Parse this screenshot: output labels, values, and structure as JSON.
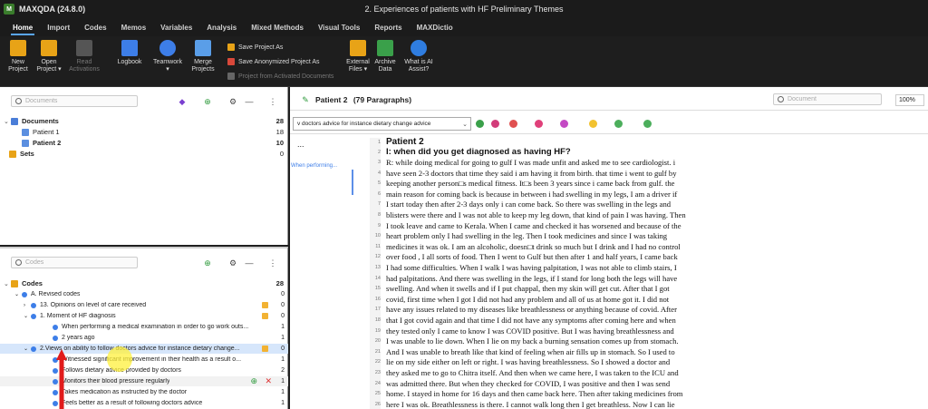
{
  "window": {
    "app_name": "MAXQDA (24.8.0)",
    "doc_title": "2. Experiences of patients with HF Preliminary Themes"
  },
  "ribbon": {
    "tabs": [
      "Home",
      "Import",
      "Codes",
      "Memos",
      "Variables",
      "Analysis",
      "Mixed Methods",
      "Visual Tools",
      "Reports",
      "MAXDictio"
    ],
    "buttons": [
      {
        "label": "New\nProject",
        "icon": "new-project-icon"
      },
      {
        "label": "Open\nProject ▾",
        "icon": "open-project-icon"
      },
      {
        "label": "Read\nActivations",
        "icon": "read-icon",
        "disabled": true
      },
      {
        "label": "Logbook",
        "icon": "logbook-icon"
      },
      {
        "label": "Teamwork\n▾",
        "icon": "teamwork-icon"
      },
      {
        "label": "Merge\nProjects",
        "icon": "merge-icon"
      },
      {
        "label": "External\nFiles ▾",
        "icon": "external-files-icon"
      },
      {
        "label": "Archive\nData",
        "icon": "archive-icon"
      },
      {
        "label": "What is AI\nAssist?",
        "icon": "ai-assist-icon"
      }
    ],
    "small_buttons": [
      "Save Project As",
      "Save Anonymized Project As",
      "Project from Activated Documents"
    ]
  },
  "documents": {
    "search_placeholder": "Documents",
    "root": {
      "label": "Documents",
      "count": "28"
    },
    "items": [
      {
        "label": "Patient 1",
        "count": "18"
      },
      {
        "label": "Patient 2",
        "count": "10"
      }
    ],
    "sets": {
      "label": "Sets",
      "count": "0"
    }
  },
  "codes": {
    "search_placeholder": "Codes",
    "root": {
      "label": "Codes",
      "count": "28"
    },
    "rows": [
      {
        "label": "A. Revised codes",
        "count": "0"
      },
      {
        "label": "13. Opinions on level of care received",
        "count": "0"
      },
      {
        "label": "1. Moment of HF diagnosis",
        "count": "0"
      },
      {
        "label": "When performing a medical examination in order to go work outs...",
        "count": "1"
      },
      {
        "label": "2 years ago",
        "count": "1"
      },
      {
        "label": "2.Views on ability to follow doctors advice for instance dietary change...",
        "count": "0"
      },
      {
        "label": "Witnessed significant improvement in their health as a result o...",
        "count": "1"
      },
      {
        "label": "Follows dietary advice provided by doctors",
        "count": "2"
      },
      {
        "label": "Monitors their blood pressure regularly",
        "count": "1"
      },
      {
        "label": "Takes medication as instructed by the doctor",
        "count": "1"
      },
      {
        "label": "Feels better as a result of following doctors advice",
        "count": "1"
      }
    ]
  },
  "document_browser": {
    "title": "Patient 2",
    "paragraphs": "(79 Paragraphs)",
    "search_placeholder": "Document",
    "zoom": "100%",
    "code_combo": "v doctors advice for instance dietary change advice",
    "margin_label": "When performing...",
    "ellipsis": "...",
    "lines": [
      {
        "n": "1",
        "text": "Patient 2",
        "style": "h1"
      },
      {
        "n": "2",
        "text": "I: when did you get diagnosed as having HF?",
        "style": "h2"
      },
      {
        "n": "3",
        "text": "R: while doing medical for going to gulf I was made unfit and asked me to see cardiologist. i"
      },
      {
        "n": "4",
        "text": "have seen 2-3 doctors that time they said i am having it from birth. that time i went to gulf by"
      },
      {
        "n": "5",
        "text": "keeping another person□s medical fitness. It□s been 3 years since i came back from gulf. the"
      },
      {
        "n": "6",
        "text": "main reason for coming back is because in between i had swelling in my legs, I am a driver if"
      },
      {
        "n": "7",
        "text": "I start today then after 2-3 days only i can come back. So there was swelling in the legs and"
      },
      {
        "n": "8",
        "text": "blisters were there and I was not able to keep my leg down, that kind of pain I was having. Then"
      },
      {
        "n": "9",
        "text": "I took leave and came to Kerala. When I came and checked it has worsened and because of the"
      },
      {
        "n": "10",
        "text": "heart problem only I had swelling in the leg. Then I took medicines and since I was taking"
      },
      {
        "n": "11",
        "text": "medicines it was ok. I am an alcoholic, doesn□t drink so much but I drink and I had no control"
      },
      {
        "n": "12",
        "text": "over food , I all sorts of food. Then I went to Gulf but then after 1 and half years, I came back"
      },
      {
        "n": "13",
        "text": "I had some difficulties. When I walk I was having palpitation, I was not able to climb stairs, I"
      },
      {
        "n": "14",
        "text": "had palpitations. And there was swelling in the legs, if I stand for long both the legs will have"
      },
      {
        "n": "15",
        "text": "swelling. And when it swells and if I put chappal, then my skin will get cut. After that I got"
      },
      {
        "n": "16",
        "text": "covid, first time when I got I did not had any problem and all of us at home got it. I did not"
      },
      {
        "n": "17",
        "text": "have any issues related to my diseases like breathlessness or anything because of covid. After"
      },
      {
        "n": "18",
        "text": "that I got covid again and that time I did not have any symptoms after coming here and when"
      },
      {
        "n": "19",
        "text": "they tested only I came to know I was COVID positive. But I was having breathlessness and"
      },
      {
        "n": "20",
        "text": "I was unable to lie down. When I lie on my back a burning sensation comes up from stomach."
      },
      {
        "n": "21",
        "text": "And I was unable to breath like that kind of feeling when air fills up in stomach. So I used to"
      },
      {
        "n": "22",
        "text": "lie on my side either on left or right. I was having breathlessness. So I showed a doctor and"
      },
      {
        "n": "23",
        "text": "they asked me to go to Chitra itself. And then when we came here, I was taken to the ICU and"
      },
      {
        "n": "24",
        "text": "was admitted there. But when they checked for COVID, I was positive and then I was send"
      },
      {
        "n": "25",
        "text": "home. I stayed in home for 16 days and then came back here. Then after taking medicines from"
      },
      {
        "n": "26",
        "text": "here I was ok. Breathlessness is there. I cannot walk long then I get breathless. Now I can lie"
      }
    ]
  },
  "colors": {
    "accent": "#5aa6f5",
    "annotation_arrow": "#e11b1b",
    "highlight": "#fff03c",
    "code_dot": "#3d7ee8"
  }
}
